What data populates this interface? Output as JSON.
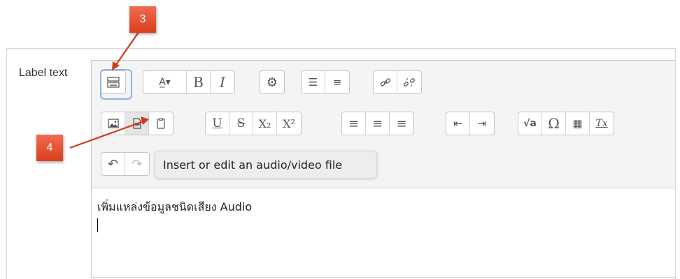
{
  "form": {
    "label": "Label text"
  },
  "toolbar": {
    "row1": [
      {
        "icon": "show-more-buttons-icon"
      },
      {
        "icon": "font-style-icon",
        "label": "A̲▾"
      },
      {
        "icon": "bold-icon",
        "label": "B"
      },
      {
        "icon": "italic-icon",
        "label": "I"
      },
      {
        "icon": "settings-gear-icon",
        "label": "⚙"
      },
      {
        "icon": "unordered-list-icon",
        "label": "☰"
      },
      {
        "icon": "ordered-list-icon",
        "label": "≡"
      },
      {
        "icon": "link-icon",
        "label": "🔗"
      },
      {
        "icon": "unlink-icon",
        "label": "✂"
      }
    ],
    "row2": [
      {
        "icon": "image-icon",
        "label": "▨"
      },
      {
        "icon": "media-icon",
        "label": "▶"
      },
      {
        "icon": "manage-files-icon",
        "label": "⎘"
      },
      {
        "icon": "underline-icon",
        "label": "U"
      },
      {
        "icon": "strikethrough-icon",
        "label": "S"
      },
      {
        "icon": "subscript-icon",
        "label": "X₂"
      },
      {
        "icon": "superscript-icon",
        "label": "X²"
      },
      {
        "icon": "align-left-icon",
        "label": "≡"
      },
      {
        "icon": "align-center-icon",
        "label": "≡"
      },
      {
        "icon": "align-right-icon",
        "label": "≡"
      },
      {
        "icon": "outdent-icon",
        "label": "⇤"
      },
      {
        "icon": "indent-icon",
        "label": "⇥"
      },
      {
        "icon": "equation-icon",
        "label": "√a"
      },
      {
        "icon": "special-character-icon",
        "label": "Ω"
      },
      {
        "icon": "table-icon",
        "label": "▦"
      },
      {
        "icon": "clear-formatting-icon",
        "label": "Tx"
      }
    ],
    "row3": [
      {
        "icon": "undo-icon",
        "label": "↶"
      },
      {
        "icon": "redo-icon",
        "label": "↷"
      }
    ]
  },
  "editor": {
    "content": "เพิ่มแหล่งข้อมูลชนิดเสียง Audio"
  },
  "tooltip": {
    "text": "Insert or edit an audio/video file"
  },
  "markers": [
    {
      "label": "3"
    },
    {
      "label": "4"
    }
  ],
  "colors": {
    "marker": "#e2502f",
    "arrow": "#d0391b",
    "focus_ring": "#8fb4e8"
  }
}
